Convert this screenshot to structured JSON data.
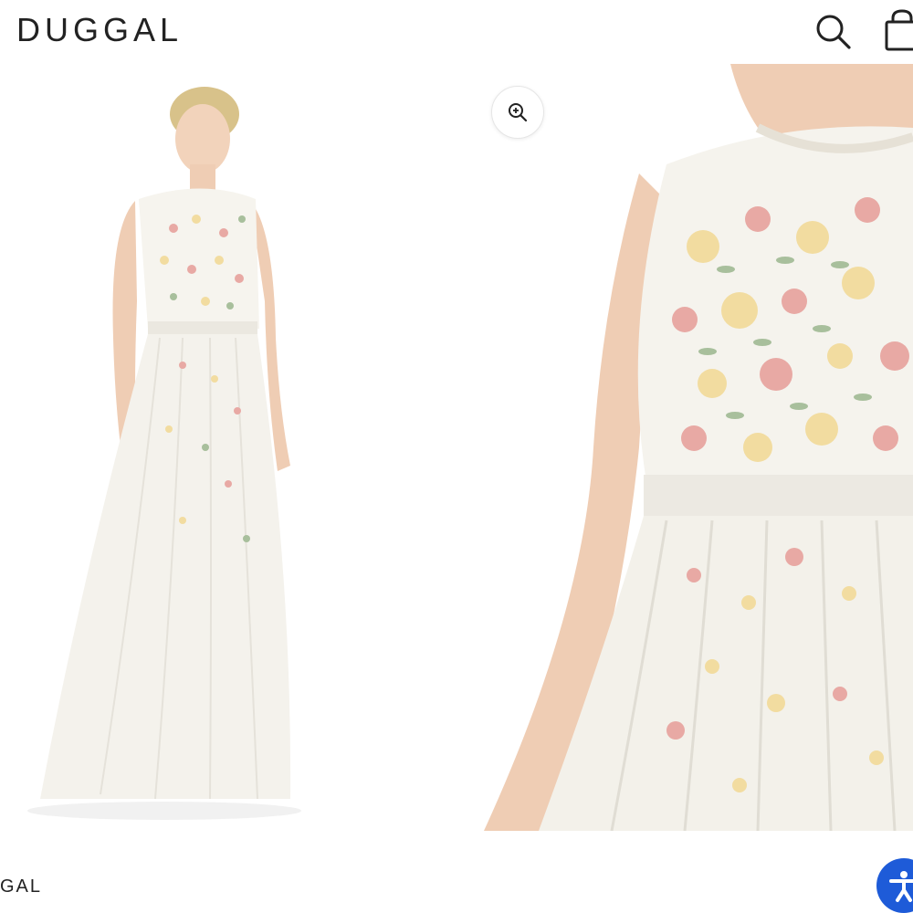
{
  "header": {
    "logo_text": "DUGGAL",
    "search_icon": "search-icon",
    "cart_icon": "shopping-bag-icon"
  },
  "gallery": {
    "zoom_icon": "zoom-in-icon",
    "image_left": "full-length-dress-image",
    "image_right": "bodice-closeup-image"
  },
  "footer": {
    "brand_text": "GAL",
    "accessibility_icon": "accessibility-icon"
  },
  "colors": {
    "text": "#222222",
    "accent": "#1e5bd8",
    "dress": "#f4f1ea",
    "flower_pink": "#e8a9a4",
    "flower_yellow": "#f2dca0",
    "leaf_green": "#a8bf9c"
  }
}
